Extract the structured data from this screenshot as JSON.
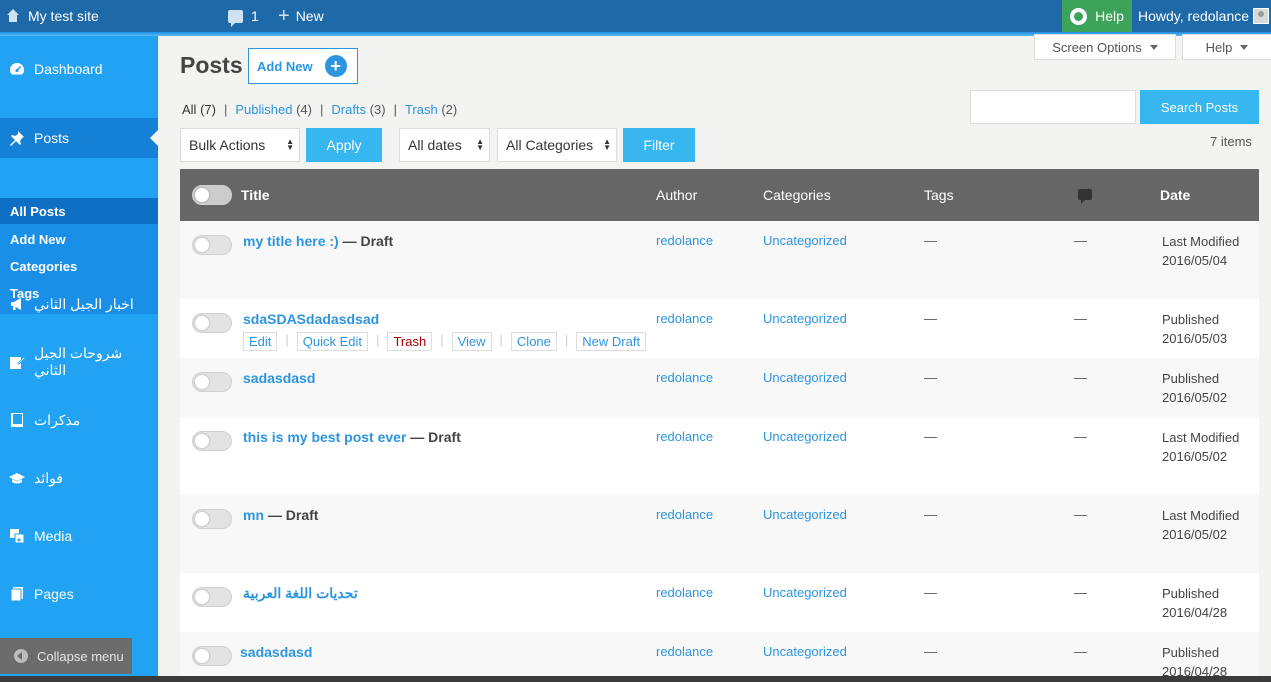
{
  "adminbar": {
    "site_name": "My test site",
    "comments_count": "1",
    "new_label": "New",
    "help_label": "Help",
    "howdy": "Howdy, redolance"
  },
  "sidebar": {
    "items": [
      {
        "label": "Dashboard",
        "icon": "dashboard-icon"
      },
      {
        "label": "Posts",
        "icon": "pin-icon"
      },
      {
        "label": "اخبار الجيل الثاني",
        "icon": "megaphone-icon"
      },
      {
        "label": "شروحات الجيل الثاني",
        "icon": "edit-icon"
      },
      {
        "label": "مذكرات",
        "icon": "book-icon"
      },
      {
        "label": "فوائد",
        "icon": "graduation-cap-icon"
      },
      {
        "label": "Media",
        "icon": "media-icon"
      },
      {
        "label": "Pages",
        "icon": "pages-icon"
      }
    ],
    "submenu": [
      "All Posts",
      "Add New",
      "Categories",
      "Tags"
    ],
    "collapse_label": "Collapse menu"
  },
  "page": {
    "title": "Posts",
    "add_new": "Add New",
    "screen_options": "Screen Options",
    "help": "Help"
  },
  "filters": {
    "all": "All",
    "all_count": "(7)",
    "published": "Published",
    "published_count": "(4)",
    "drafts": "Drafts",
    "drafts_count": "(3)",
    "trash": "Trash",
    "trash_count": "(2)",
    "sep": "|",
    "bulk_actions": "Bulk Actions",
    "apply": "Apply",
    "all_dates": "All dates",
    "all_categories": "All Categories",
    "filter": "Filter",
    "search_button": "Search Posts",
    "search_value": "",
    "items_count": "7 items"
  },
  "table": {
    "headers": {
      "title": "Title",
      "author": "Author",
      "categories": "Categories",
      "tags": "Tags",
      "date": "Date"
    },
    "rows": [
      {
        "title": "my title here :)",
        "state": " — Draft",
        "author": "redolance",
        "category": "Uncategorized",
        "tags": "—",
        "comments": "—",
        "date_status": "Last Modified",
        "date": "2016/05/04"
      },
      {
        "title": "sdaSDASdadasdsad",
        "state": "",
        "author": "redolance",
        "category": "Uncategorized",
        "tags": "—",
        "comments": "—",
        "date_status": "Published",
        "date": "2016/05/03"
      },
      {
        "title": "sadasdasd",
        "state": "",
        "author": "redolance",
        "category": "Uncategorized",
        "tags": "—",
        "comments": "—",
        "date_status": "Published",
        "date": "2016/05/02"
      },
      {
        "title": "this is my best post ever",
        "state": " — Draft",
        "author": "redolance",
        "category": "Uncategorized",
        "tags": "—",
        "comments": "—",
        "date_status": "Last Modified",
        "date": "2016/05/02"
      },
      {
        "title": "mn",
        "state": " — Draft",
        "author": "redolance",
        "category": "Uncategorized",
        "tags": "—",
        "comments": "—",
        "date_status": "Last Modified",
        "date": "2016/05/02"
      },
      {
        "title": "تحديات اللغة العربية",
        "state": "",
        "author": "redolance",
        "category": "Uncategorized",
        "tags": "—",
        "comments": "—",
        "date_status": "Published",
        "date": "2016/04/28"
      },
      {
        "title": "sadasdasd",
        "state": "",
        "author": "redolance",
        "category": "Uncategorized",
        "tags": "—",
        "comments": "—",
        "date_status": "Published",
        "date": "2016/04/28"
      }
    ],
    "row_actions": [
      "Edit",
      "Quick Edit",
      "Trash",
      "View",
      "Clone",
      "New Draft"
    ]
  },
  "colors": {
    "adminbar": "#1e6aa8",
    "sidebar": "#21a2f2",
    "accent": "#2d95e0",
    "button": "#37b6f0",
    "help": "#3da35a"
  }
}
